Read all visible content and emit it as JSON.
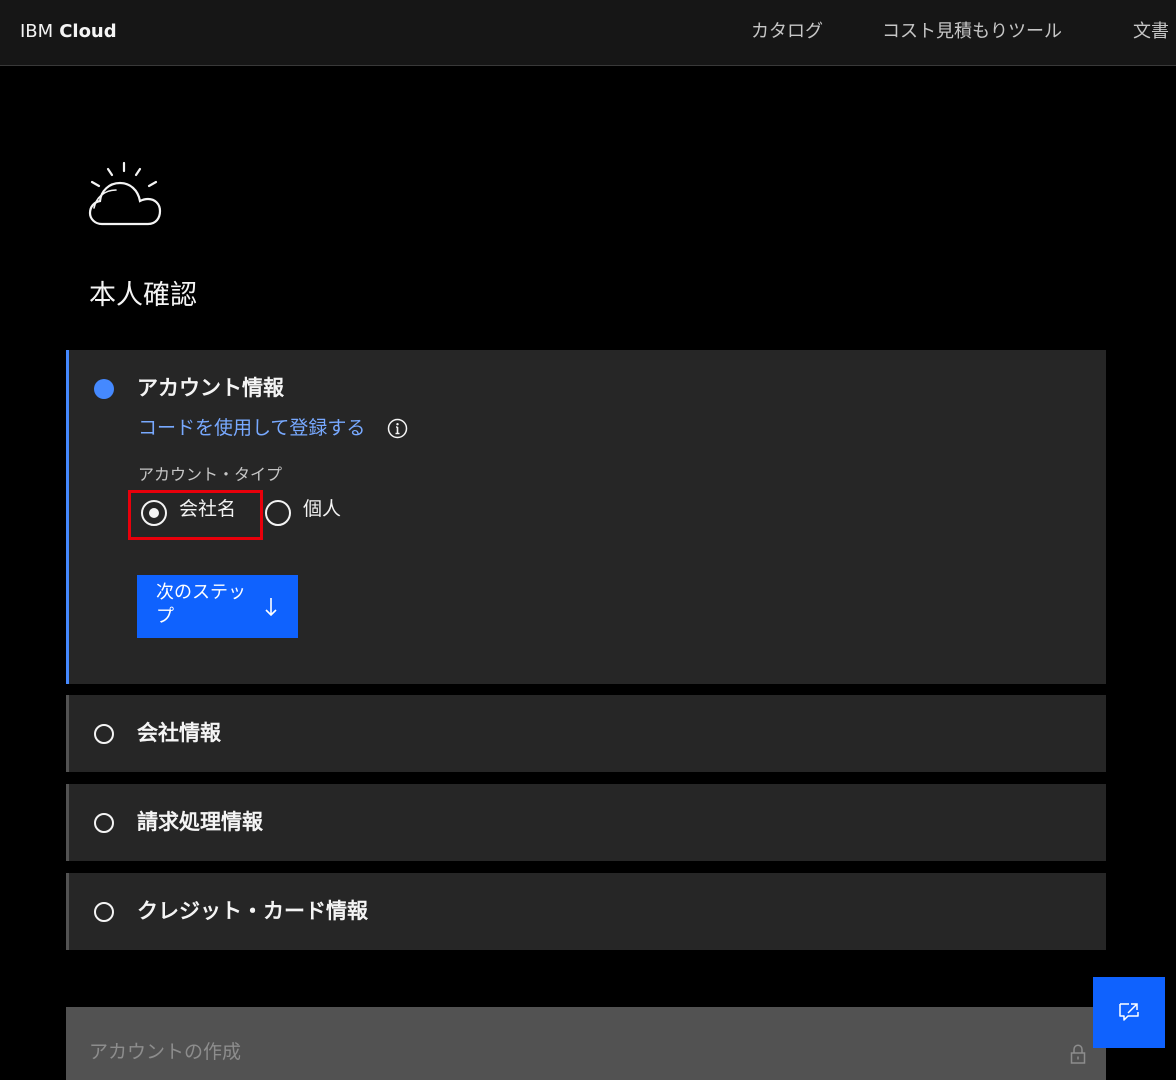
{
  "header": {
    "brand_prefix": "IBM",
    "brand_name": "Cloud",
    "nav": [
      "カタログ",
      "コスト見積もりツール",
      "文書"
    ]
  },
  "page": {
    "title": "本人確認"
  },
  "steps": [
    {
      "title": "アカウント情報",
      "state": "active",
      "code_link": "コードを使用して登録する",
      "account_type_label": "アカウント・タイプ",
      "options": [
        {
          "label": "会社名",
          "selected": true
        },
        {
          "label": "個人",
          "selected": false
        }
      ],
      "next_button": "次のステップ"
    },
    {
      "title": "会社情報",
      "state": "pending"
    },
    {
      "title": "請求処理情報",
      "state": "pending"
    },
    {
      "title": "クレジット・カード情報",
      "state": "pending"
    }
  ],
  "create_account": {
    "label": "アカウントの作成",
    "locked": true
  },
  "icons": {
    "logo": "ibm-cloud-logo-icon",
    "info": "info-icon",
    "next": "arrow-down-icon",
    "lock": "lock-icon",
    "feedback": "feedback-icon"
  },
  "colors": {
    "accent": "#0f62fe",
    "active_step": "#4589ff",
    "link": "#78a9ff",
    "highlight": "#e8000b",
    "panel": "#262626"
  }
}
